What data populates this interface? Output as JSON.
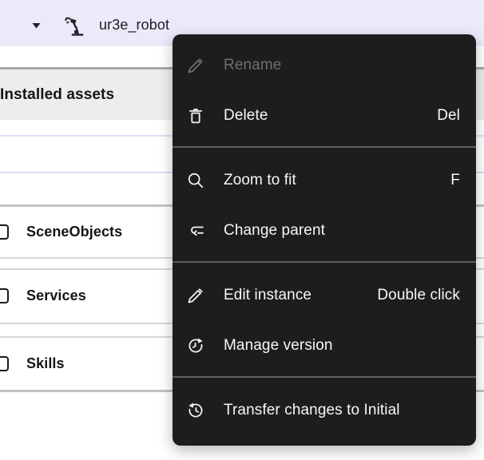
{
  "header": {
    "entity_label": "ur3e_robot",
    "caret_icon": "caret-down-icon",
    "entity_icon": "robot-arm-icon"
  },
  "panel": {
    "section_title": "Installed assets",
    "rows": [
      {
        "label": "SceneObjects",
        "checked": false
      },
      {
        "label": "Services",
        "checked": false
      },
      {
        "label": "Skills",
        "checked": false
      }
    ]
  },
  "context_menu": {
    "items": [
      {
        "id": "rename",
        "label": "Rename",
        "icon": "pencil-icon",
        "shortcut": "",
        "disabled": true
      },
      {
        "id": "delete",
        "label": "Delete",
        "icon": "trash-icon",
        "shortcut": "Del",
        "disabled": false
      },
      {
        "type": "separator"
      },
      {
        "id": "zoom-to-fit",
        "label": "Zoom to fit",
        "icon": "magnifier-icon",
        "shortcut": "F",
        "disabled": false
      },
      {
        "id": "change-parent",
        "label": "Change parent",
        "icon": "change-parent-icon",
        "shortcut": "",
        "disabled": false
      },
      {
        "type": "separator"
      },
      {
        "id": "edit-instance",
        "label": "Edit instance",
        "icon": "pencil-icon",
        "shortcut": "Double click",
        "disabled": false
      },
      {
        "id": "manage-version",
        "label": "Manage version",
        "icon": "clock-refresh-icon",
        "shortcut": "",
        "disabled": false
      },
      {
        "type": "separator"
      },
      {
        "id": "transfer-changes",
        "label": "Transfer changes to Initial",
        "icon": "history-icon",
        "shortcut": "",
        "disabled": false
      }
    ]
  },
  "colors": {
    "header_background": "#ECEAF9",
    "section_band_background": "#EDEDED",
    "menu_background": "#1D1D1E",
    "menu_text": "#F7F7F7",
    "menu_disabled_text": "#6F6F6F",
    "menu_separator": "#5E5E5E",
    "panel_text": "#151515",
    "row_separator": "#D7D7D7"
  }
}
